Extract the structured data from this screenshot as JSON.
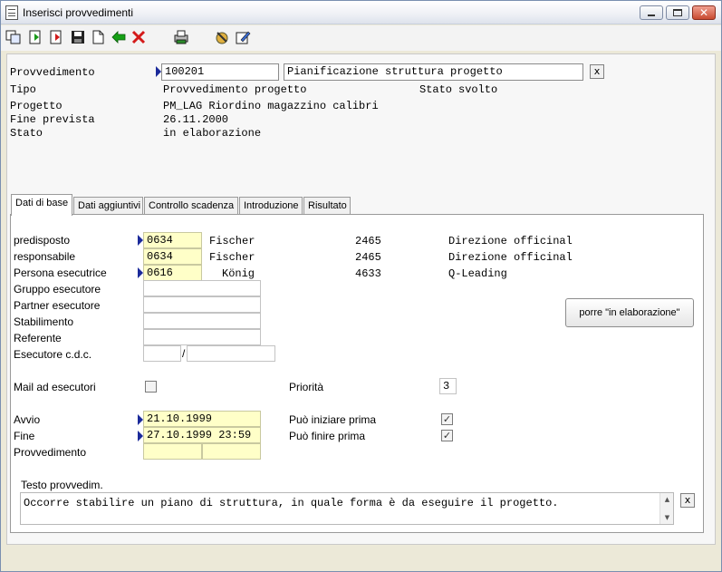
{
  "window": {
    "title": "Inserisci provvedimenti"
  },
  "toolbar": {
    "icons": [
      "copy-icon",
      "new-record-icon",
      "delete-record-icon",
      "save-icon",
      "blank-page-icon",
      "back-arrow-icon",
      "cancel-icon",
      "print-icon",
      "tools-icon",
      "edit-form-icon"
    ]
  },
  "header": {
    "provvedimento_label": "Provvedimento",
    "provvedimento_number": "100201",
    "provvedimento_desc": "Pianificazione struttura progetto",
    "tipo_label": "Tipo",
    "tipo_value": "Provvedimento progetto",
    "stato_top_label": "Stato",
    "stato_top_value": "svolto",
    "progetto_label": "Progetto",
    "progetto_value": "PM_LAG Riordino magazzino calibri",
    "fine_prevista_label": "Fine prevista",
    "fine_prevista_value": "26.11.2000",
    "stato_label": "Stato",
    "stato_value": "in elaborazione",
    "clear_label": "x"
  },
  "tabs": [
    {
      "label": "Dati di base"
    },
    {
      "label": "Dati aggiuntivi"
    },
    {
      "label": "Controllo scadenza"
    },
    {
      "label": "Introduzione"
    },
    {
      "label": "Risultato"
    }
  ],
  "base": {
    "predisposto_label": "predisposto",
    "predisposto_code": "0634",
    "predisposto_name": "Fischer",
    "predisposto_num": "2465",
    "predisposto_dept": "Direzione officinal",
    "responsabile_label": "responsabile",
    "responsabile_code": "0634",
    "responsabile_name": "Fischer",
    "responsabile_num": "2465",
    "responsabile_dept": "Direzione officinal",
    "esecutrice_label": "Persona esecutrice",
    "esecutrice_code": "0616",
    "esecutrice_name": "König",
    "esecutrice_num": "4633",
    "esecutrice_dept": "Q-Leading",
    "gruppo_label": "Gruppo esecutore",
    "partner_label": "Partner esecutore",
    "stabilimento_label": "Stabilimento",
    "referente_label": "Referente",
    "esecutore_cdc_label": "Esecutore c.d.c.",
    "cdc_separator": "/",
    "mail_label": "Mail ad esecutori",
    "priorita_label": "Priorità",
    "priorita_value": "3",
    "avvio_label": "Avvio",
    "avvio_value": "21.10.1999",
    "fine_label": "Fine",
    "fine_value": "27.10.1999 23:59",
    "provvedimento_label": "Provvedimento",
    "puo_iniziare_label": "Può iniziare prima",
    "puo_finire_label": "Può finire prima",
    "check_mark": "✓",
    "porre_button": "porre \"in elaborazione\"",
    "testo_label": "Testo provvedim.",
    "testo_value": "Occorre stabilire un piano di struttura, in quale forma è da eseguire il progetto."
  }
}
